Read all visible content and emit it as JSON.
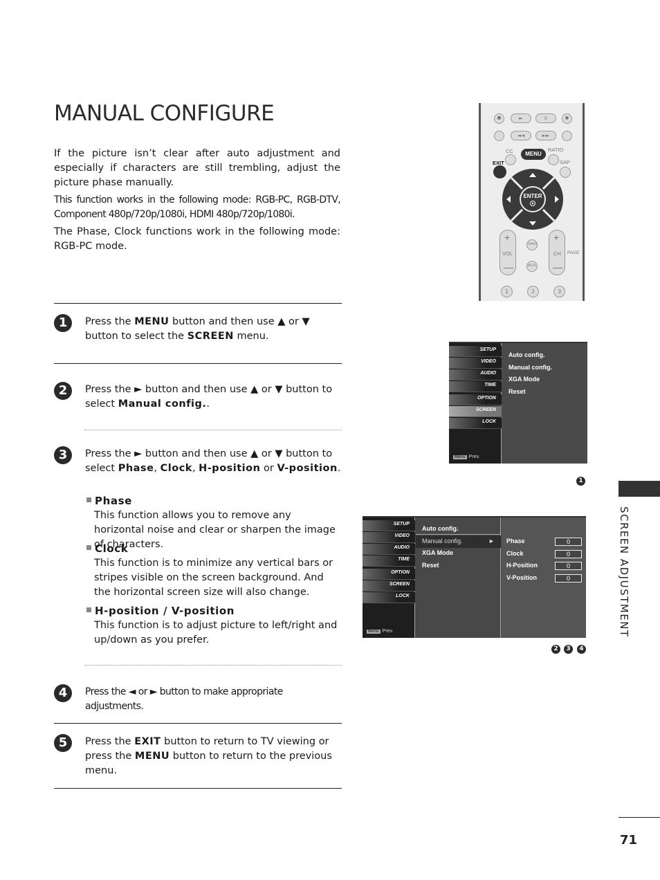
{
  "page": {
    "title": "MANUAL CONFIGURE",
    "section_tab": "SCREEN ADJUSTMENT",
    "page_number": "71"
  },
  "intro": [
    "If the picture isn’t clear after auto adjustment and especially if characters are still trembling, adjust the picture phase manually.",
    "This function works in the following mode: RGB-PC, RGB-DTV, Component 480p/720p/1080i, HDMI 480p/720p/1080i.",
    "The Phase, Clock functions work in the following mode: RGB-PC mode."
  ],
  "steps": [
    {
      "number": "1",
      "parts": [
        "Press the ",
        "MENU",
        " button and then use ▲ or ▼ button to select the ",
        "SCREEN",
        " menu."
      ]
    },
    {
      "number": "2",
      "parts": [
        "Press the ► button and then use ▲ or ▼ button to select ",
        "Manual config.",
        "."
      ]
    },
    {
      "number": "3",
      "parts": [
        "Press the ► button and then use ▲ or ▼ button to select ",
        "Phase",
        ", ",
        "Clock",
        ", ",
        "H-position",
        " or ",
        "V-position",
        "."
      ],
      "subitems": [
        {
          "head": "Phase",
          "desc": "This function allows you to remove any horizontal noise and clear or sharpen the image of characters."
        },
        {
          "head": "Clock",
          "desc": "This function is to minimize any vertical bars or stripes visible on the screen background. And the horizontal screen size will also change."
        },
        {
          "head": "H-position / V-position",
          "desc": "This function is to adjust picture to left/right and up/down as you prefer."
        }
      ]
    },
    {
      "number": "4",
      "text": "Press the ◄ or ► button to make appropriate adjustments."
    },
    {
      "number": "5",
      "parts": [
        "Press the ",
        "EXIT",
        " button to return to TV viewing or press the ",
        "MENU",
        " button to return to the previous menu."
      ]
    }
  ],
  "remote": {
    "menu": "MENU",
    "exit": "EXIT",
    "cc": "CC",
    "ratio": "RATIO",
    "sap": "SAP",
    "enter": "ENTER",
    "vol": "VOL",
    "ch": "CH",
    "page": "PAGE",
    "timer": "TIMER",
    "mute": "MUTE",
    "numbers": [
      "1",
      "2",
      "3"
    ],
    "transport_top": [
      "■",
      "►",
      "II",
      "●"
    ],
    "transport_bottom": [
      "◄◄",
      "◄◄",
      "►►",
      "►►"
    ]
  },
  "osd_menu_1": {
    "sidebar": [
      "SETUP",
      "VIDEO",
      "AUDIO",
      "TIME",
      "OPTION",
      "SCREEN",
      "LOCK"
    ],
    "active": "SCREEN",
    "items": [
      "Auto config.",
      "Manual config.",
      "XGA Mode",
      "Reset"
    ],
    "footer_key": "Menu",
    "footer": "Prev.",
    "callout": "1"
  },
  "osd_menu_2": {
    "sidebar": [
      "SETUP",
      "VIDEO",
      "AUDIO",
      "TIME",
      "OPTION",
      "SCREEN",
      "LOCK"
    ],
    "items": [
      "Auto config.",
      "Manual config.",
      "XGA Mode",
      "Reset"
    ],
    "selected": "Manual config.",
    "arrow": "►",
    "settings": [
      {
        "label": "Phase",
        "value": "0"
      },
      {
        "label": "Clock",
        "value": "0"
      },
      {
        "label": "H-Position",
        "value": "0"
      },
      {
        "label": "V-Position",
        "value": "0"
      }
    ],
    "footer_key": "Menu",
    "footer": "Prev.",
    "callouts": [
      "2",
      "3",
      "4"
    ]
  }
}
